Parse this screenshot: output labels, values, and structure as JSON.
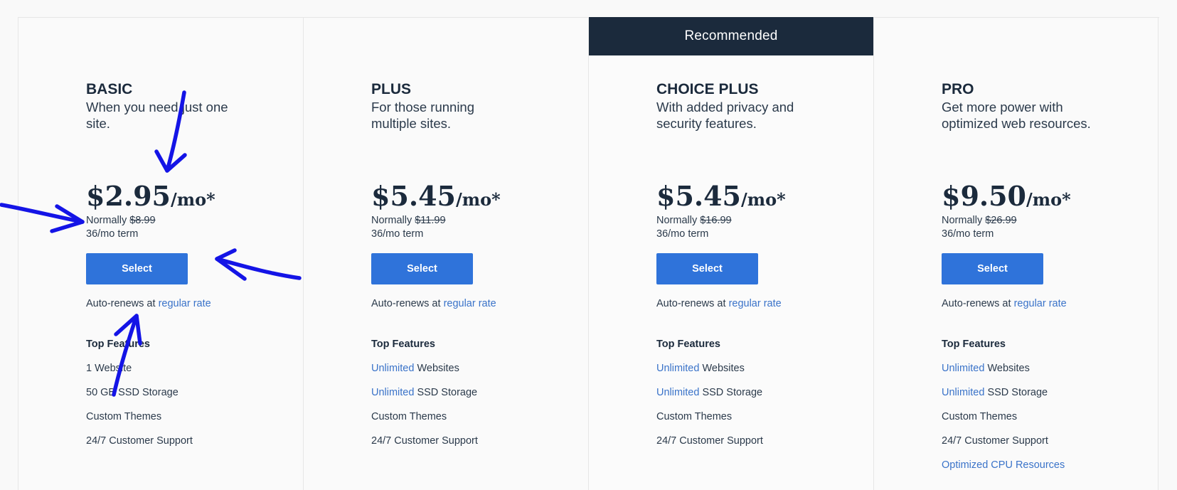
{
  "plans": [
    {
      "name": "BASIC",
      "description": "When you need just one site.",
      "price": "$2.95",
      "unit": "/mo*",
      "normally_label": "Normally",
      "normally_price": "$8.99",
      "term": "36/mo term",
      "select_label": "Select",
      "autorenew_text": "Auto-renews at",
      "autorenew_link": "regular rate",
      "features_title": "Top Features",
      "features": [
        {
          "highlight": "",
          "text": "1 Website"
        },
        {
          "highlight": "",
          "text": "50 GB SSD Storage"
        },
        {
          "highlight": "",
          "text": "Custom Themes"
        },
        {
          "highlight": "",
          "text": "24/7 Customer Support"
        }
      ]
    },
    {
      "name": "PLUS",
      "description": "For those running multiple sites.",
      "price": "$5.45",
      "unit": "/mo*",
      "normally_label": "Normally",
      "normally_price": "$11.99",
      "term": "36/mo term",
      "select_label": "Select",
      "autorenew_text": "Auto-renews at",
      "autorenew_link": "regular rate",
      "features_title": "Top Features",
      "features": [
        {
          "highlight": "Unlimited",
          "text": " Websites"
        },
        {
          "highlight": "Unlimited",
          "text": " SSD Storage"
        },
        {
          "highlight": "",
          "text": "Custom Themes"
        },
        {
          "highlight": "",
          "text": "24/7 Customer Support"
        }
      ]
    },
    {
      "ribbon": "Recommended",
      "name": "CHOICE PLUS",
      "description": "With added privacy and security features.",
      "price": "$5.45",
      "unit": "/mo*",
      "normally_label": "Normally",
      "normally_price": "$16.99",
      "term": "36/mo term",
      "select_label": "Select",
      "autorenew_text": "Auto-renews at",
      "autorenew_link": "regular rate",
      "features_title": "Top Features",
      "features": [
        {
          "highlight": "Unlimited",
          "text": " Websites"
        },
        {
          "highlight": "Unlimited",
          "text": " SSD Storage"
        },
        {
          "highlight": "",
          "text": "Custom Themes"
        },
        {
          "highlight": "",
          "text": "24/7 Customer Support"
        }
      ]
    },
    {
      "name": "PRO",
      "description": "Get more power with optimized web resources.",
      "price": "$9.50",
      "unit": "/mo*",
      "normally_label": "Normally",
      "normally_price": "$26.99",
      "term": "36/mo term",
      "select_label": "Select",
      "autorenew_text": "Auto-renews at",
      "autorenew_link": "regular rate",
      "features_title": "Top Features",
      "features": [
        {
          "highlight": "Unlimited",
          "text": " Websites"
        },
        {
          "highlight": "Unlimited",
          "text": " SSD Storage"
        },
        {
          "highlight": "",
          "text": "Custom Themes"
        },
        {
          "highlight": "",
          "text": "24/7 Customer Support"
        },
        {
          "highlight": "Optimized CPU Resources",
          "text": ""
        }
      ]
    }
  ],
  "colors": {
    "ribbon": "#1b2a3c",
    "button": "#2f73da",
    "link": "#3a73c9",
    "annotation": "#1414e6"
  }
}
